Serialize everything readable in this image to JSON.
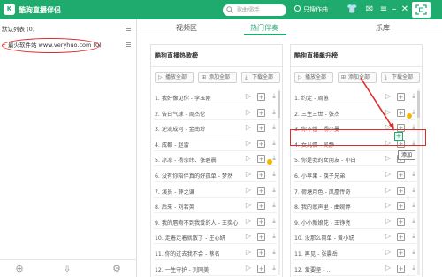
{
  "titlebar": {
    "app_title": "酷狗直播伴侣",
    "search_placeholder": "歌曲/歌手",
    "only_song_label": "只搜作曲",
    "icons": [
      "shirt-icon",
      "mail-icon",
      "menu-icon",
      "minimize-icon",
      "close-icon",
      "scan-icon"
    ]
  },
  "left_panel": {
    "lists": [
      {
        "label": "默认列表 (0)"
      },
      {
        "label": "最火软件站 www.veryhuo.com (0)"
      }
    ]
  },
  "tabs": [
    "视频区",
    "热门伴奏",
    "乐库"
  ],
  "active_tab": "热门伴奏",
  "cards": [
    {
      "title": "酷狗直播热歌榜",
      "buttons": [
        "播放全部",
        "添加全部",
        "下载全部"
      ],
      "songs": [
        {
          "title": "1. 我好像见你 - 李玉刚",
          "vip": false
        },
        {
          "title": "2. 告白气球 - 周杰伦",
          "vip": false
        },
        {
          "title": "3. 逆流成河 - 金南玲",
          "vip": false
        },
        {
          "title": "4. 成都 - 赵雷",
          "vip": false
        },
        {
          "title": "5. 凉凉 - 杨宗纬、张碧晨",
          "vip": true
        },
        {
          "title": "6. 没有你陪伴真的好孤单 - 梦然",
          "vip": false
        },
        {
          "title": "7. 演员 - 薛之谦",
          "vip": false
        },
        {
          "title": "8. 后来 - 刘若英",
          "vip": false
        },
        {
          "title": "9. 我的唇吻不到我爱的人 - 王奕心",
          "vip": false
        },
        {
          "title": "10. 走着走着就散了 - 庄心妍",
          "vip": false
        },
        {
          "title": "11. 你的过去我不会 - 蔡名",
          "vip": false
        },
        {
          "title": "12. 一生守护 - 刘同美",
          "vip": false
        }
      ]
    },
    {
      "title": "酷狗直播飙升榜",
      "buttons": [
        "播放全部",
        "添加全部",
        "下载全部"
      ],
      "songs": [
        {
          "title": "1. 约定 - 周蕙",
          "vip": false
        },
        {
          "title": "2. 三生三世 - 张杰",
          "vip": true
        },
        {
          "title": "3. 你不懂 - 杨小曼",
          "vip": false
        },
        {
          "title": "4. 女儿情 - 吴静",
          "vip": false
        },
        {
          "title": "5. 你是我的女朋友 - 小白",
          "vip": false
        },
        {
          "title": "6. 小苹果 - 筷子兄弟",
          "vip": false
        },
        {
          "title": "7. 荷塘月色 - 凤凰传奇",
          "vip": false
        },
        {
          "title": "8. 我的歌声里 - 曲婉婷",
          "vip": false
        },
        {
          "title": "9. 小小新娘花 - 王铮亮",
          "vip": false
        },
        {
          "title": "10. 没那么简单 - 黄小琥",
          "vip": false
        },
        {
          "title": "11. 再见 - 张震岳",
          "vip": false
        },
        {
          "title": "12. 爱要坚 - ...",
          "vip": false
        }
      ]
    }
  ],
  "tooltip": "添加",
  "colors": {
    "brand": "#1faa6e",
    "annotation": "#e02b2b",
    "vip": "#f5b400"
  }
}
